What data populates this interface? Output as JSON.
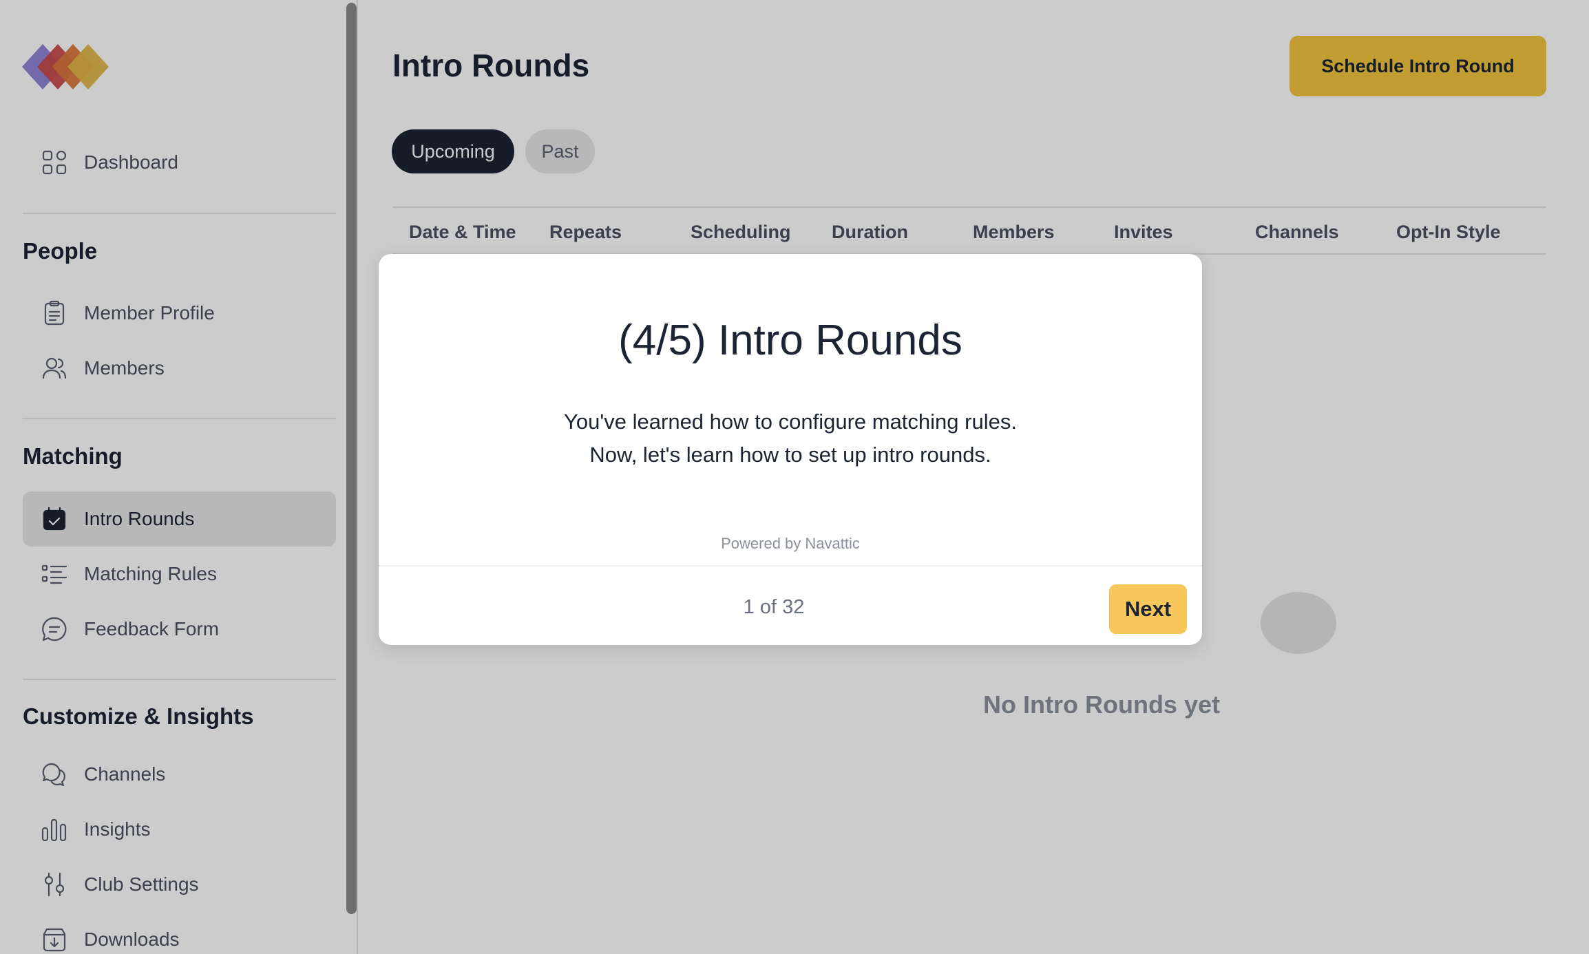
{
  "sidebar": {
    "logo_colors": [
      "#8f85d6",
      "#c94a4a",
      "#d9773a",
      "#e1b548"
    ],
    "items": [
      {
        "label": "Dashboard",
        "icon": "dashboard-grid-icon"
      },
      {
        "label": "Member Profile",
        "icon": "clipboard-icon"
      },
      {
        "label": "Members",
        "icon": "users-icon"
      },
      {
        "label": "Intro Rounds",
        "icon": "calendar-check-icon",
        "active": true
      },
      {
        "label": "Matching Rules",
        "icon": "list-icon"
      },
      {
        "label": "Feedback Form",
        "icon": "message-icon"
      },
      {
        "label": "Channels",
        "icon": "chat-bubbles-icon"
      },
      {
        "label": "Insights",
        "icon": "bar-chart-icon"
      },
      {
        "label": "Club Settings",
        "icon": "sliders-icon"
      },
      {
        "label": "Downloads",
        "icon": "download-box-icon"
      }
    ],
    "sections": {
      "people": "People",
      "matching": "Matching",
      "customize": "Customize & Insights"
    }
  },
  "main": {
    "title": "Intro Rounds",
    "schedule_button": "Schedule Intro Round",
    "tabs": [
      {
        "label": "Upcoming",
        "active": true
      },
      {
        "label": "Past",
        "active": false
      }
    ],
    "columns": [
      "Date & Time",
      "Repeats",
      "Scheduling",
      "Duration",
      "Members",
      "Invites",
      "Channels",
      "Opt-In Style"
    ],
    "empty_text": "No Intro Rounds yet"
  },
  "modal": {
    "title": "(4/5) Intro Rounds",
    "body_line1": "You've learned how to configure matching rules.",
    "body_line2": "Now, let's learn how to set up intro rounds.",
    "powered_by": "Powered by Navattic",
    "progress": "1 of 32",
    "next_button": "Next"
  },
  "colors": {
    "accent_yellow": "#f3c63f",
    "next_yellow": "#f7c75b",
    "dark_navy": "#1c2333"
  }
}
